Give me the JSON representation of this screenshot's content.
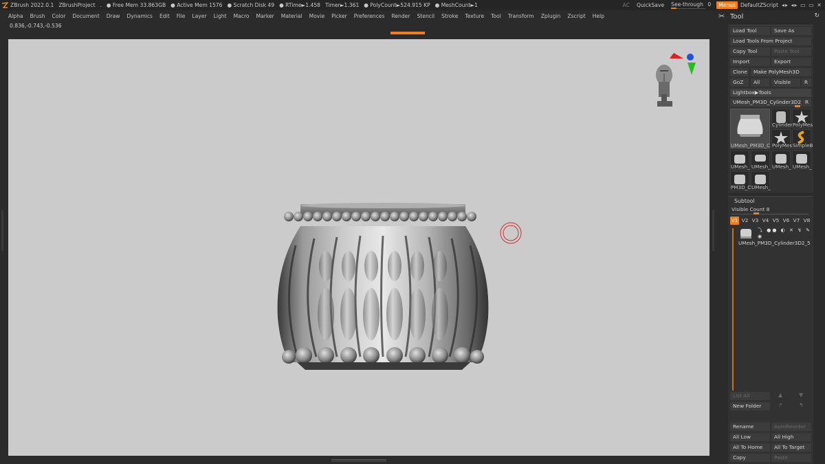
{
  "status": {
    "app": "ZBrush 2022.0.1",
    "project": "ZBrushProject",
    "dot": ".",
    "free_mem": "● Free Mem 33.863GB",
    "active_mem": "● Active Mem 1576",
    "scratch": "● Scratch Disk 49",
    "rtime": "● RTime►1.458",
    "timer": "Timer►1.361",
    "polycount": "● PolyCount►524.915 KP",
    "meshcount": "● MeshCount►1",
    "ac": "AC",
    "quicksave": "QuickSave",
    "see_through_label": "See-through",
    "see_through_value": "0",
    "see_through_level": 0.0,
    "menus": "Menus",
    "script": "DefaultZScript"
  },
  "menu": [
    "Alpha",
    "Brush",
    "Color",
    "Document",
    "Draw",
    "Dynamics",
    "Edit",
    "File",
    "Layer",
    "Light",
    "Macro",
    "Marker",
    "Material",
    "Movie",
    "Picker",
    "Preferences",
    "Render",
    "Stencil",
    "Stroke",
    "Texture",
    "Tool",
    "Transform",
    "Zplugin",
    "Zscript",
    "Help"
  ],
  "coords": "0.836,-0.743,-0.536",
  "tool": {
    "title": "Tool",
    "load_tool": "Load Tool",
    "save_as": "Save As",
    "load_from_project": "Load Tools From Project",
    "copy_tool": "Copy Tool",
    "paste_tool": "Paste Tool",
    "import": "Import",
    "export": "Export",
    "clone": "Clone",
    "make_polymesh": "Make PolyMesh3D",
    "goz": "GoZ",
    "all": "All",
    "visible": "Visible",
    "r": "R",
    "lightbox": "Lightbox▶Tools",
    "current_tool": "UMesh_PM3D_Cylinder3D2_5",
    "current_r": "R",
    "thumbs": {
      "big": "UMesh_PM3D_C",
      "cylinder": "Cylinder",
      "polymesh1": "PolyMes",
      "polymesh2": "PolyMes",
      "simple": "SimpleB",
      "row3": [
        "UMesh_",
        "UMesh_",
        "UMesh_",
        "UMesh_"
      ],
      "row4": [
        "PM3D_C",
        "UMesh_"
      ]
    }
  },
  "subtool": {
    "title": "Subtool",
    "visible_count": "Visible Count 8",
    "v_tabs": [
      "V1",
      "V2",
      "V3",
      "V4",
      "V5",
      "V6",
      "V7",
      "V8"
    ],
    "item_name": "UMesh_PM3D_Cylinder3D2_5",
    "list_all": "List All",
    "new_folder": "New Folder",
    "rename": "Rename",
    "autoreorder": "AutoReorder",
    "all_low": "All Low",
    "all_high": "All High",
    "all_to_home": "All To Home",
    "all_to_target": "All To Target",
    "copy": "Copy",
    "paste": "Paste"
  }
}
